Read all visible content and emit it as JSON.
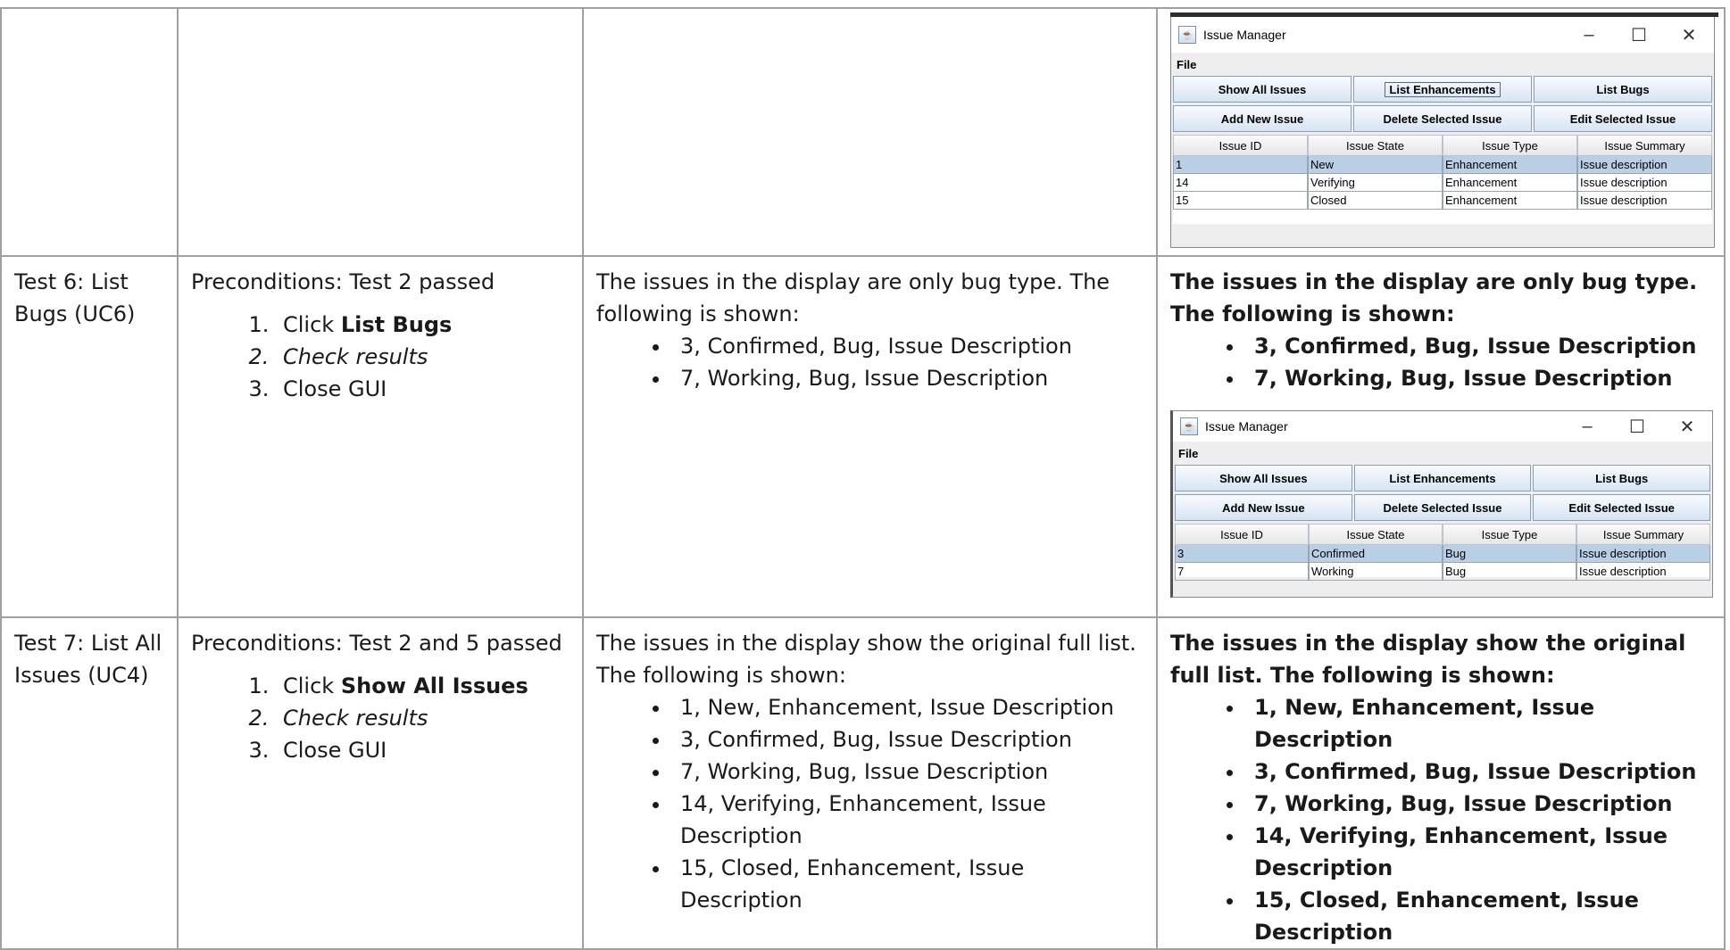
{
  "window": {
    "title": "Issue Manager",
    "menu": "File",
    "buttons_row1": [
      "Show All Issues",
      "List Enhancements",
      "List Bugs"
    ],
    "buttons_row2": [
      "Add New Issue",
      "Delete Selected Issue",
      "Edit Selected Issue"
    ],
    "columns": [
      "Issue ID",
      "Issue State",
      "Issue Type",
      "Issue Summary"
    ],
    "controls": {
      "minimize": "–",
      "maximize": "☐",
      "close": "✕"
    }
  },
  "top_window_rows": [
    [
      "1",
      "New",
      "Enhancement",
      "Issue description"
    ],
    [
      "14",
      "Verifying",
      "Enhancement",
      "Issue description"
    ],
    [
      "15",
      "Closed",
      "Enhancement",
      "Issue description"
    ]
  ],
  "test6": {
    "name": "Test 6: List Bugs (UC6)",
    "preconditions": "Preconditions: Test 2 passed",
    "step1_prefix": "Click ",
    "step1_bold": "List Bugs",
    "step2": "Check results",
    "step3": "Close GUI",
    "expected_intro": "The issues in the display are only bug type. The following is shown:",
    "expected_items": [
      "3, Confirmed, Bug, Issue Description",
      "7, Working, Bug, Issue Description"
    ],
    "actual_intro": "The issues in the display are only bug type. The following is shown:",
    "actual_items": [
      "3, Confirmed, Bug, Issue Description",
      "7, Working, Bug, Issue Description"
    ],
    "window_rows": [
      [
        "3",
        "Confirmed",
        "Bug",
        "Issue description"
      ],
      [
        "7",
        "Working",
        "Bug",
        "Issue description"
      ]
    ]
  },
  "test7": {
    "name": "Test 7: List All Issues (UC4)",
    "preconditions": "Preconditions: Test 2 and 5 passed",
    "step1_prefix": "Click ",
    "step1_bold": "Show All Issues",
    "step2": "Check results",
    "step3": "Close GUI",
    "expected_intro": "The issues in the display show the original full list. The following is shown:",
    "expected_items": [
      "1, New, Enhancement, Issue Description",
      "3, Confirmed, Bug, Issue Description",
      "7, Working, Bug, Issue Description",
      "14, Verifying, Enhancement, Issue Description",
      "15, Closed, Enhancement, Issue Description"
    ],
    "actual_intro": "The issues in the display show the original full list. The following is shown:",
    "actual_items": [
      "1, New, Enhancement, Issue Description",
      "3, Confirmed, Bug, Issue Description",
      "7, Working, Bug, Issue Description",
      "14, Verifying, Enhancement, Issue Description",
      "15, Closed, Enhancement, Issue Description"
    ]
  }
}
